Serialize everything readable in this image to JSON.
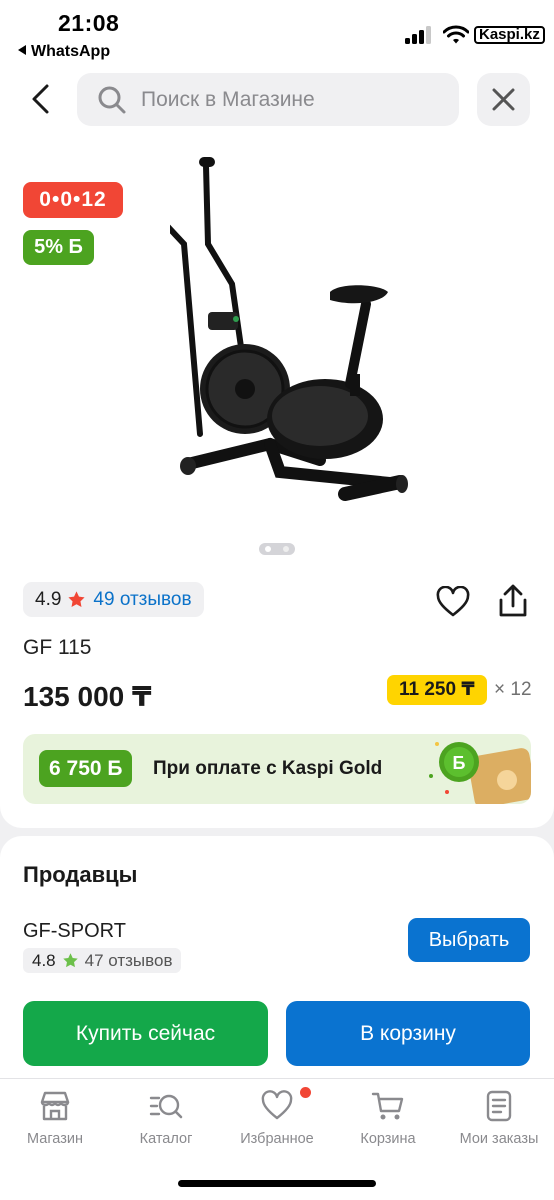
{
  "status_bar": {
    "time": "21:08",
    "back_app": "WhatsApp",
    "carrier": "Kaspi.kz"
  },
  "topbar": {
    "search_placeholder": "Поиск в Магазине",
    "back_icon": "chevron-left-icon",
    "close_icon": "close-icon"
  },
  "product": {
    "promo_installment": "0•0•12",
    "bonus_badge": "5% Б",
    "gallery_pages": 2,
    "gallery_current": 1,
    "rating": "4.9",
    "reviews_label": "49 отзывов",
    "name": "GF 115",
    "price": "135 000 ₸",
    "monthly": "11 250 ₸",
    "months": "× 12",
    "gold_bonus": "6 750 Б",
    "gold_text": "При оплате с Kaspi Gold"
  },
  "sellers": {
    "title": "Продавцы",
    "name": "GF-SPORT",
    "rating": "4.8",
    "reviews": "47 отзывов",
    "choose_label": "Выбрать",
    "buy_now_label": "Купить сейчас",
    "add_to_cart_label": "В корзину"
  },
  "bottom_nav": [
    {
      "label": "Магазин",
      "icon": "store-icon"
    },
    {
      "label": "Каталог",
      "icon": "catalog-search-icon"
    },
    {
      "label": "Избранное",
      "icon": "heart-icon",
      "badge": true
    },
    {
      "label": "Корзина",
      "icon": "cart-icon"
    },
    {
      "label": "Мои заказы",
      "icon": "orders-icon"
    }
  ],
  "colors": {
    "brand_red": "#f14635",
    "bonus_green": "#4ca320",
    "primary_blue": "#0a73d0",
    "buy_green": "#14a84a",
    "installment_yellow": "#ffd400",
    "link_blue": "#0b72c9"
  }
}
